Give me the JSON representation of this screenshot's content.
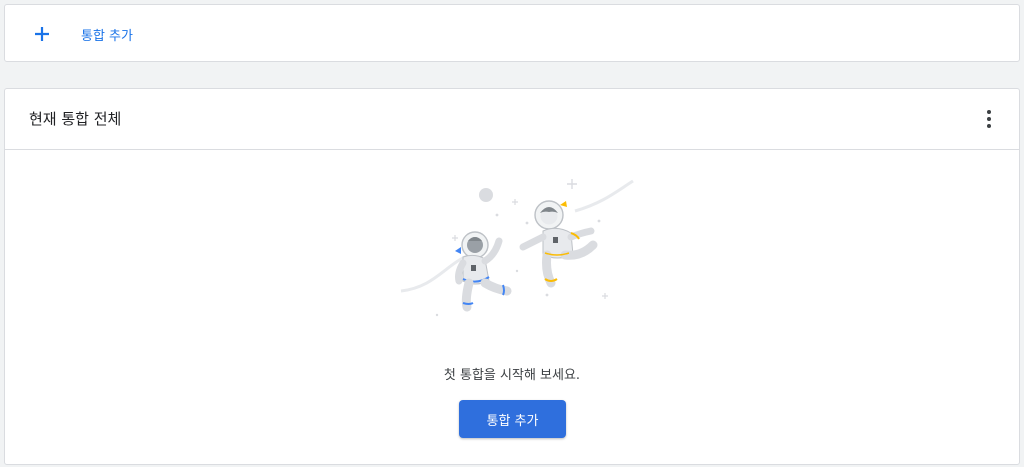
{
  "add_card": {
    "icon": "plus-icon",
    "label": "통합 추가"
  },
  "integrations": {
    "title": "현재 통합 전체",
    "more_icon": "more-vert-icon",
    "illustration": "astronauts-illustration",
    "empty_message": "첫 통합을 시작해 보세요.",
    "add_button_label": "통합 추가"
  },
  "colors": {
    "accent": "#1a73e8",
    "button": "#2f6fdd",
    "background": "#f1f3f4"
  }
}
